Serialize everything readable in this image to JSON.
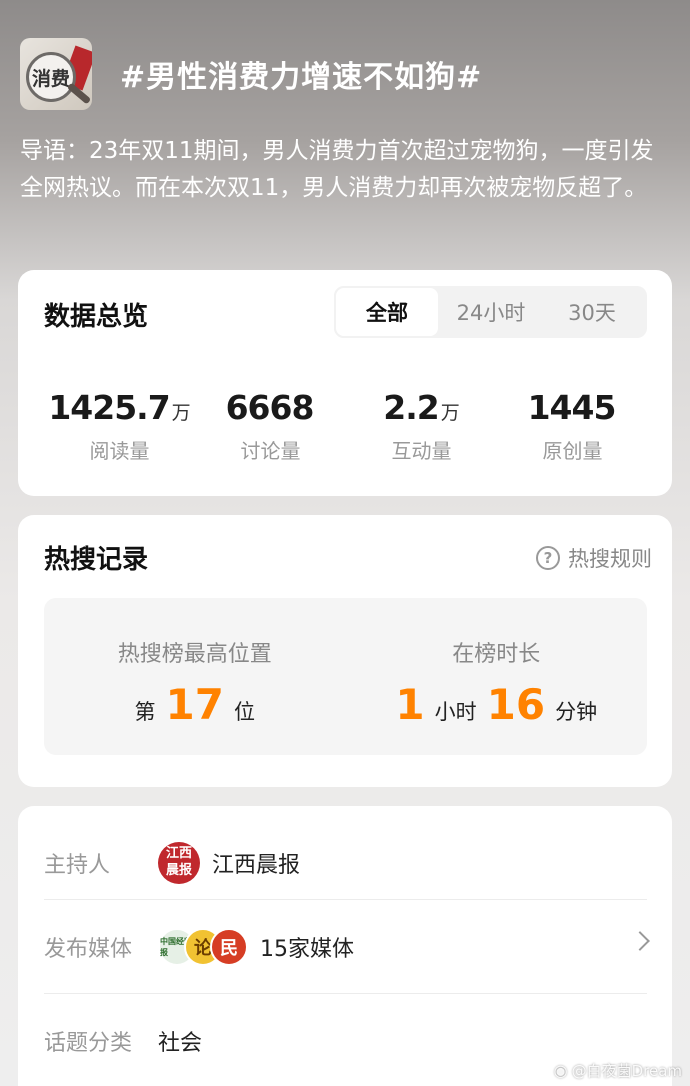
{
  "topic": {
    "title": "#男性消费力增速不如狗#",
    "thumb_text": "消费",
    "intro": "导语：23年双11期间，男人消费力首次超过宠物狗，一度引发全网热议。而在本次双11，男人消费力却再次被宠物反超了。"
  },
  "overview": {
    "title": "数据总览",
    "tabs": [
      "全部",
      "24小时",
      "30天"
    ],
    "active_tab": "全部",
    "stats": [
      {
        "value": "1425.7",
        "unit": "万",
        "label": "阅读量"
      },
      {
        "value": "6668",
        "unit": "",
        "label": "讨论量"
      },
      {
        "value": "2.2",
        "unit": "万",
        "label": "互动量"
      },
      {
        "value": "1445",
        "unit": "",
        "label": "原创量"
      }
    ]
  },
  "hot_search": {
    "title": "热搜记录",
    "rules_label": "热搜规则",
    "rules_icon": "question-circle-icon",
    "peak_label": "热搜榜最高位置",
    "peak_prefix": "第",
    "peak_value": "17",
    "peak_suffix": "位",
    "duration_label": "在榜时长",
    "duration_hours": "1",
    "duration_hours_unit": "小时",
    "duration_minutes": "16",
    "duration_minutes_unit": "分钟"
  },
  "info": {
    "host_label": "主持人",
    "host_name": "江西晨报",
    "host_logo_text": [
      "江",
      "西",
      "晨",
      "报"
    ],
    "media_label": "发布媒体",
    "media_count": "15家媒体",
    "media_logo_text": [
      "中国经营报",
      "论",
      "民"
    ],
    "category_label": "话题分类",
    "category_value": "社会"
  },
  "watermark": "@白夜菌Dream",
  "colors": {
    "accent": "#ff8200",
    "host_logo": "#c0282d"
  }
}
